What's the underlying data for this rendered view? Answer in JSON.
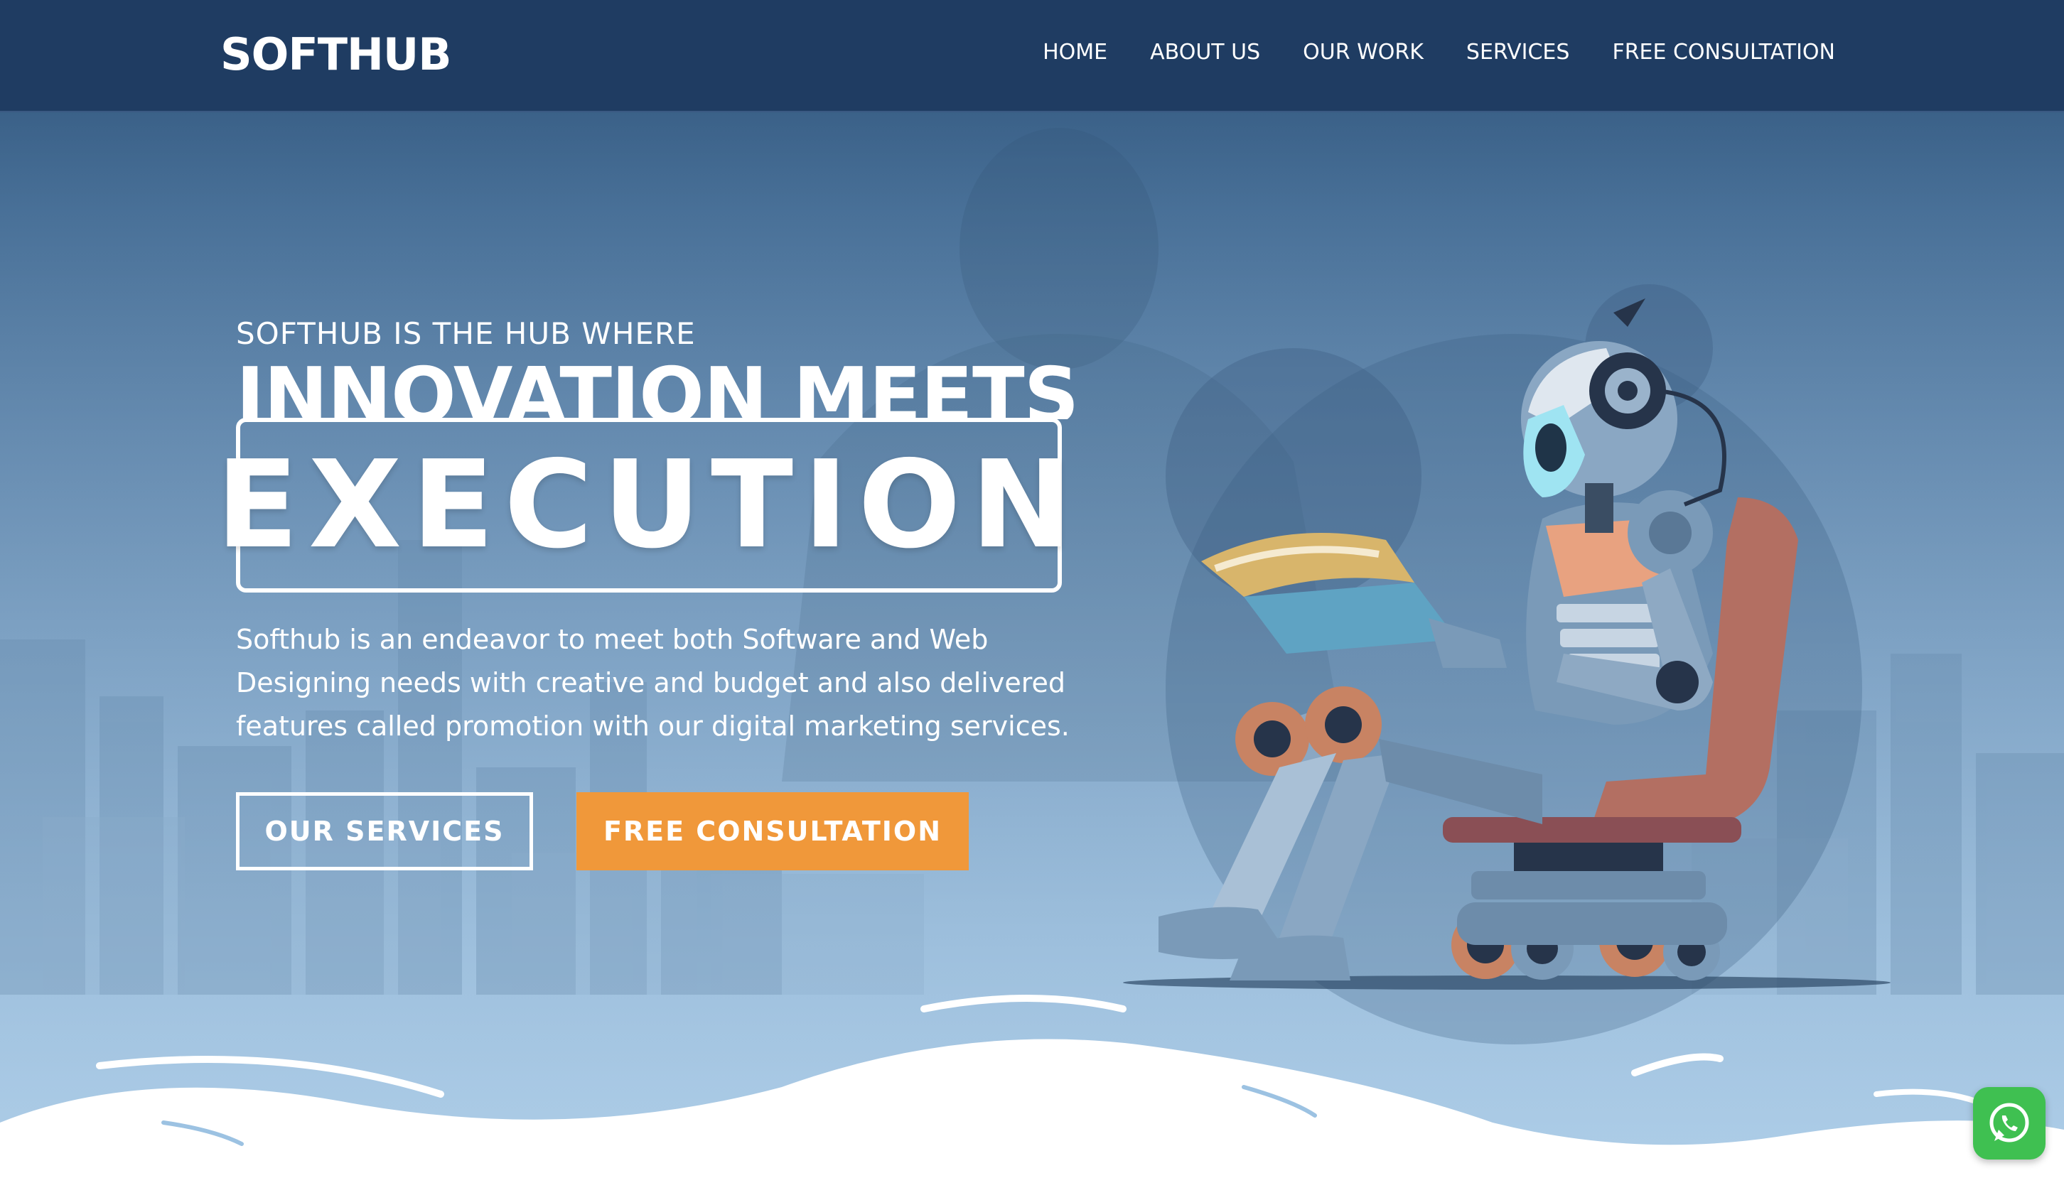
{
  "header": {
    "logo": "SOFTHUB",
    "nav": [
      "HOME",
      "ABOUT US",
      "OUR WORK",
      "SERVICES",
      "FREE CONSULTATION"
    ]
  },
  "hero": {
    "eyebrow": "SOFTHUB IS THE HUB WHERE",
    "headline": "INNOVATION MEETS",
    "highlight": "EXECUTION",
    "description": "Softhub is an endeavor to meet both Software and Web Designing needs with creative and budget and also delivered features called promotion with our digital marketing services.",
    "primary_button": "OUR SERVICES",
    "secondary_button": "FREE CONSULTATION"
  },
  "floating": {
    "whatsapp_icon": "whatsapp-icon"
  },
  "colors": {
    "header_bg": "#1f3c62",
    "accent": "#f0983a",
    "whatsapp": "#3fc051"
  }
}
